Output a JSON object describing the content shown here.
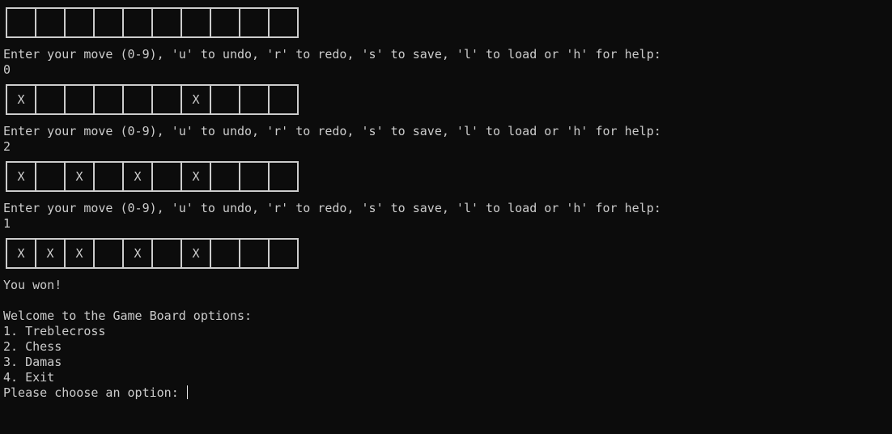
{
  "terminal": {
    "blocks": [
      {
        "cells": [
          "",
          "",
          "",
          "",
          "",
          "",
          "",
          "",
          "",
          ""
        ],
        "prompt": "Enter your move (0-9), 'u' to undo, 'r' to redo, 's' to save, 'l' to load or 'h' for help:",
        "input": "0"
      },
      {
        "cells": [
          "X",
          "",
          "",
          "",
          "",
          "",
          "X",
          "",
          "",
          ""
        ],
        "prompt": "Enter your move (0-9), 'u' to undo, 'r' to redo, 's' to save, 'l' to load or 'h' for help:",
        "input": "2"
      },
      {
        "cells": [
          "X",
          "",
          "X",
          "",
          "X",
          "",
          "X",
          "",
          "",
          ""
        ],
        "prompt": "Enter your move (0-9), 'u' to undo, 'r' to redo, 's' to save, 'l' to load or 'h' for help:",
        "input": "1"
      },
      {
        "cells": [
          "X",
          "X",
          "X",
          "",
          "X",
          "",
          "X",
          "",
          "",
          ""
        ]
      }
    ],
    "result": "You won!",
    "menu": {
      "title": "Welcome to the Game Board options:",
      "options": [
        "1. Treblecross",
        "2. Chess",
        "3. Damas",
        "4. Exit"
      ],
      "prompt": "Please choose an option: "
    },
    "colors": {
      "background": "#0c0c0c",
      "text": "#cccccc"
    }
  }
}
